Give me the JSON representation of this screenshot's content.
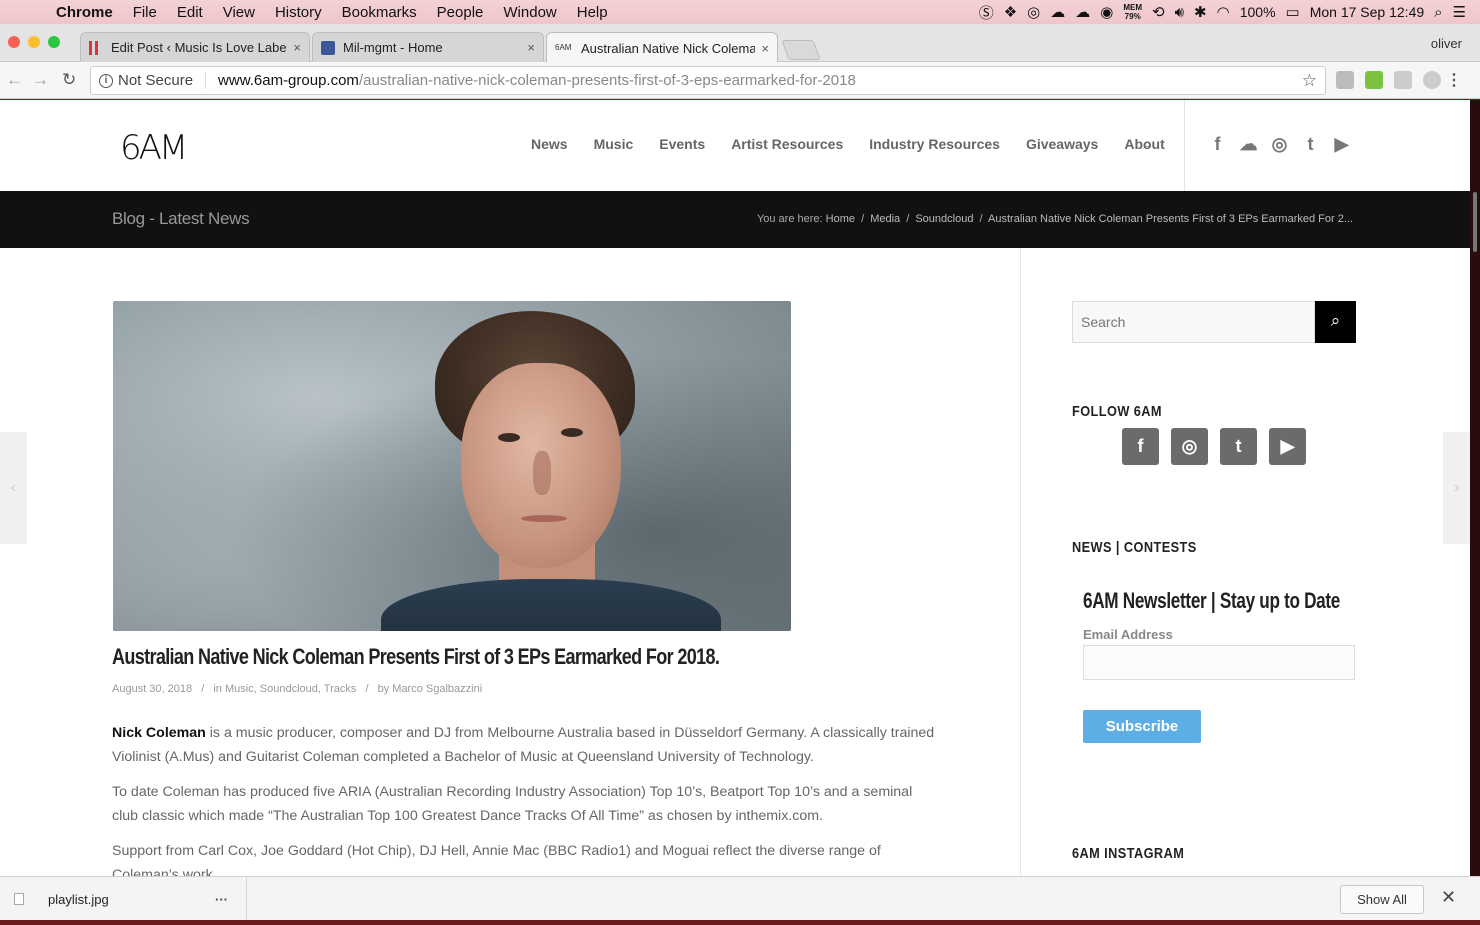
{
  "menubar": {
    "apple": "",
    "app_name": "Chrome",
    "items": [
      "File",
      "Edit",
      "View",
      "History",
      "Bookmarks",
      "People",
      "Window",
      "Help"
    ],
    "mem_label": "MEM",
    "mem_value": "79%",
    "battery": "100%",
    "clock": "Mon 17 Sep  12:49"
  },
  "tabs": [
    {
      "title": "Edit Post ‹ Music Is Love Label",
      "icon": "bars-icon",
      "close": "×"
    },
    {
      "title": "Mil-mgmt - Home",
      "icon": "facebook-icon",
      "close": "×"
    },
    {
      "title": "Australian Native Nick Coleman",
      "icon": "6am-icon",
      "close": "×"
    }
  ],
  "profile": "oliver",
  "omnibox": {
    "security": "Not Secure",
    "host": "www.6am-group.com",
    "path": "/australian-native-nick-coleman-presents-first-of-3-eps-earmarked-for-2018"
  },
  "site": {
    "logo": "6AM",
    "nav": [
      "News",
      "Music",
      "Events",
      "Artist Resources",
      "Industry Resources",
      "Giveaways",
      "About"
    ],
    "social": [
      "f",
      "☁",
      "◎",
      "t",
      "▶"
    ]
  },
  "titlebar": {
    "heading": "Blog - Latest News",
    "breadcrumb_prefix": "You are here:",
    "crumbs": [
      "Home",
      "Media",
      "Soundcloud",
      "Australian Native Nick Coleman Presents First of 3 EPs Earmarked For 2..."
    ]
  },
  "post": {
    "title": "Australian Native Nick Coleman Presents First of 3 EPs Earmarked For 2018.",
    "date": "August 30, 2018",
    "categories_prefix": "in",
    "categories": "Music, Soundcloud, Tracks",
    "author_prefix": "by",
    "author": "Marco Sgalbazzini",
    "body_lead_name": "Nick Coleman",
    "body_p1_rest": " is a music producer, composer and DJ from Melbourne Australia based in Düsseldorf Germany. A classically trained Violinist (A.Mus) and Guitarist Coleman completed a Bachelor of Music at Queensland University of Technology.",
    "body_p2": "To date Coleman has produced five ARIA (Australian Recording Industry Association) Top 10’s, Beatport Top 10’s and a seminal club classic which made “The Australian Top 100 Greatest Dance Tracks Of All Time” as chosen by inthemix.com.",
    "body_p3": "Support from Carl Cox, Joe Goddard (Hot Chip), DJ Hell, Annie Mac (BBC Radio1) and Moguai reflect the diverse range of Coleman’s work."
  },
  "sidebar": {
    "search_placeholder": "Search",
    "follow_title": "FOLLOW 6AM",
    "follow_icons": [
      "f",
      "◎",
      "t",
      "▶"
    ],
    "news_title": "NEWS | CONTESTS",
    "newsletter_title": "6AM Newsletter | Stay up to Date",
    "email_label": "Email Address",
    "subscribe_label": "Subscribe",
    "instagram_title": "6AM INSTAGRAM"
  },
  "download": {
    "file": "playlist.jpg",
    "more": "···",
    "show_all": "Show All",
    "close": "✕"
  }
}
